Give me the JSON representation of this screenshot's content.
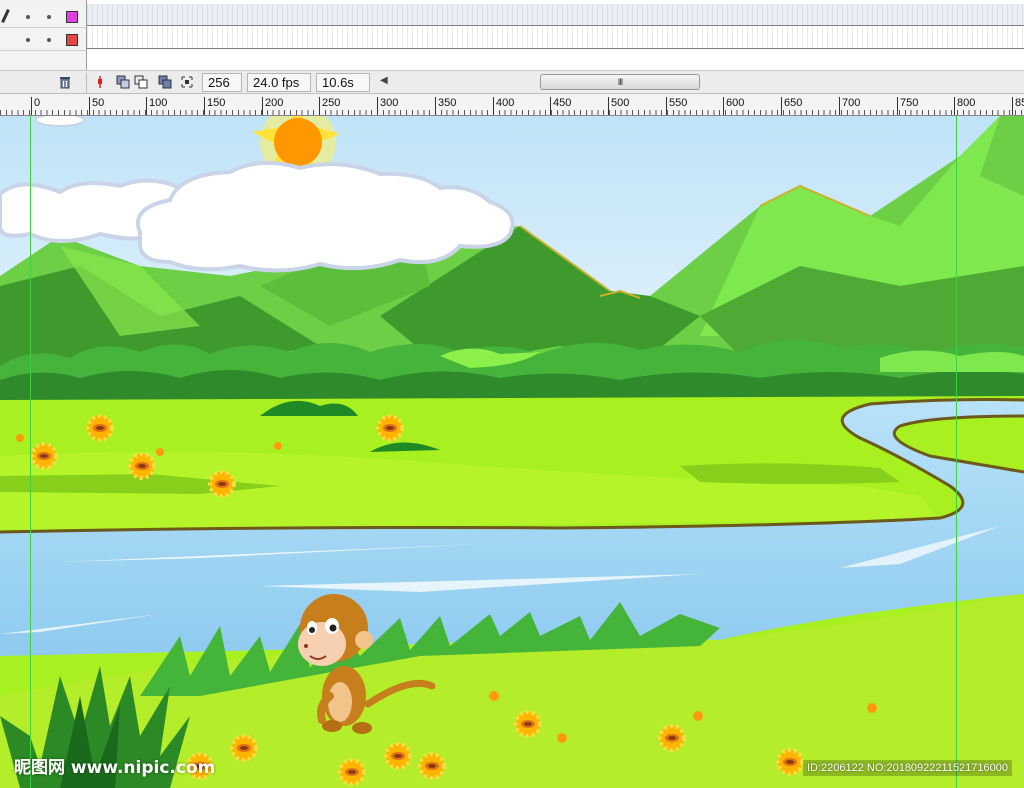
{
  "timeline": {
    "layers": [
      {
        "swatch_color": "#e040e0",
        "editing": true
      },
      {
        "swatch_color": "#e04848",
        "editing": false
      }
    ],
    "current_frame": "256",
    "frame_rate": "24.0 fps",
    "elapsed_time": "10.6s",
    "scrollbar_grip": "III",
    "icons": [
      "trash-icon",
      "onion-skin-marker-icon",
      "onion-skin-icon",
      "onion-skin-outlines-icon",
      "edit-multiple-frames-icon",
      "modify-markers-icon",
      "scroll-left-icon"
    ]
  },
  "ruler": {
    "labels": [
      "0",
      "50",
      "100",
      "150",
      "200",
      "250",
      "300",
      "350",
      "400",
      "450",
      "500",
      "550",
      "600",
      "650",
      "700",
      "750",
      "800",
      "85"
    ]
  },
  "stage": {
    "scene_elements": [
      "sun",
      "clouds",
      "mountains",
      "bushes",
      "meadow",
      "river",
      "monkey",
      "grass",
      "flowers"
    ],
    "colors": {
      "sky": "#cfe9f8",
      "mountain_light": "#6ccf45",
      "mountain_dark": "#3f9a2e",
      "meadow": "#a8f020",
      "river": "#a8d8f4",
      "sun": "#ff9800",
      "guide": "#3fcf3f"
    }
  },
  "watermark": {
    "site_cn": "昵图网",
    "site_url": "www.nipic.com",
    "id_text": "ID:2206122 NO:20180922211521716000"
  }
}
